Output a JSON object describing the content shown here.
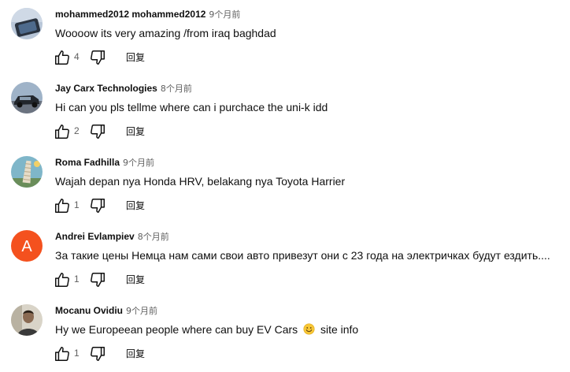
{
  "comments": [
    {
      "author": "mohammed2012 mohammed2012",
      "time": "9个月前",
      "text": "Woooow its very amazing /from iraq baghdad",
      "likes": "4",
      "reply_label": "回复",
      "avatar": "photo-of-tablet"
    },
    {
      "author": "Jay Carx Technologies",
      "time": "8个月前",
      "text": "Hi can you pls tellme where can i purchace the uni-k idd",
      "likes": "2",
      "reply_label": "回复",
      "avatar": "photo-of-car"
    },
    {
      "author": "Roma Fadhilla",
      "time": "9个月前",
      "text": "Wajah depan nya Honda HRV, belakang nya Toyota Harrier",
      "likes": "1",
      "reply_label": "回复",
      "avatar": "photo-of-tower"
    },
    {
      "author": "Andrei Evlampiev",
      "time": "8个月前",
      "text": "За такие цены Немца нам сами свои авто привезут они с 23 года на электричках будут ездить....",
      "likes": "1",
      "reply_label": "回复",
      "avatar": "letter",
      "avatar_letter": "A",
      "avatar_color": "#f4511e"
    },
    {
      "author": "Mocanu Ovidiu",
      "time": "9个月前",
      "text_before_emoji": "Hy we Europeean people where can buy EV Cars",
      "text_after_emoji": "site info",
      "emoji": "smiling-face-emoji",
      "likes": "1",
      "reply_label": "回复",
      "avatar": "photo-of-person"
    }
  ],
  "icons": {
    "like": "thumbs-up-icon",
    "dislike": "thumbs-down-icon"
  }
}
